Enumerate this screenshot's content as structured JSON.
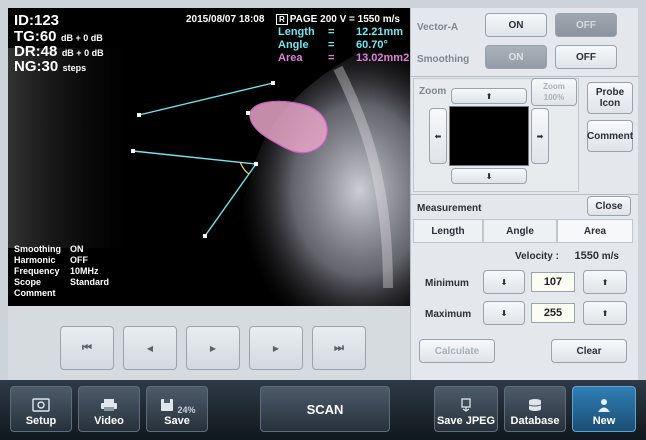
{
  "overlay": {
    "id": "ID:123",
    "tg": "TG:60",
    "tg_sub": "dB + 0 dB",
    "dr": "DR:48",
    "dr_sub": "dB + 0 dB",
    "ng": "NG:30",
    "ng_sub": "steps",
    "datetime": "2015/08/07 18:08",
    "page_icon": "R",
    "page_label": "PAGE",
    "page_num": "200",
    "velocity_readout": "V = 1550 m/s",
    "measurements": [
      {
        "key": "Length",
        "eq": "=",
        "val": "12.21mm",
        "color": "#6fe6f0"
      },
      {
        "key": "Angle",
        "eq": "=",
        "val": "60.70°",
        "color": "#6fe6f0"
      },
      {
        "key": "Area",
        "eq": "=",
        "val": "13.02mm2",
        "color": "#e080d8"
      }
    ],
    "info": [
      {
        "key": "Smoothing",
        "val": "ON"
      },
      {
        "key": "Harmonic",
        "val": "OFF"
      },
      {
        "key": "Frequency",
        "val": "10MHz"
      },
      {
        "key": "Scope",
        "val": "Standard"
      },
      {
        "key": "Comment",
        "val": ""
      }
    ]
  },
  "transport": {
    "first": "⏮",
    "prev": "◀",
    "play": "▶",
    "next": "▶",
    "last": "⏭"
  },
  "panel": {
    "vector_label": "Vector-A",
    "vector_on": "ON",
    "vector_off": "OFF",
    "smoothing_label": "Smoothing",
    "smoothing_on": "ON",
    "smoothing_off": "OFF",
    "zoom_label": "Zoom",
    "zoom_pct_label": "Zoom",
    "zoom_pct": "100%",
    "probe_icon": "Probe Icon",
    "comment": "Comment",
    "up": "⬆",
    "down": "⬇",
    "left": "⬅",
    "right": "➡",
    "measurement_label": "Measurement",
    "close": "Close",
    "tabs": [
      "Length",
      "Angle",
      "Area"
    ],
    "velocity_label": "Velocity :",
    "velocity_value": "1550",
    "velocity_unit": "m/s",
    "minimum_label": "Minimum",
    "minimum_value": "107",
    "maximum_label": "Maximum",
    "maximum_value": "255",
    "calculate": "Calculate",
    "clear": "Clear"
  },
  "bottom": {
    "setup": "Setup",
    "video": "Video",
    "save": "Save",
    "save_pct": "24%",
    "scan": "SCAN",
    "save_jpeg": "Save JPEG",
    "database": "Database",
    "new": "New"
  },
  "colors": {
    "accent_cyan": "#6fe6f0",
    "accent_magenta": "#e080d8",
    "new_button": "#2f7fb5"
  }
}
